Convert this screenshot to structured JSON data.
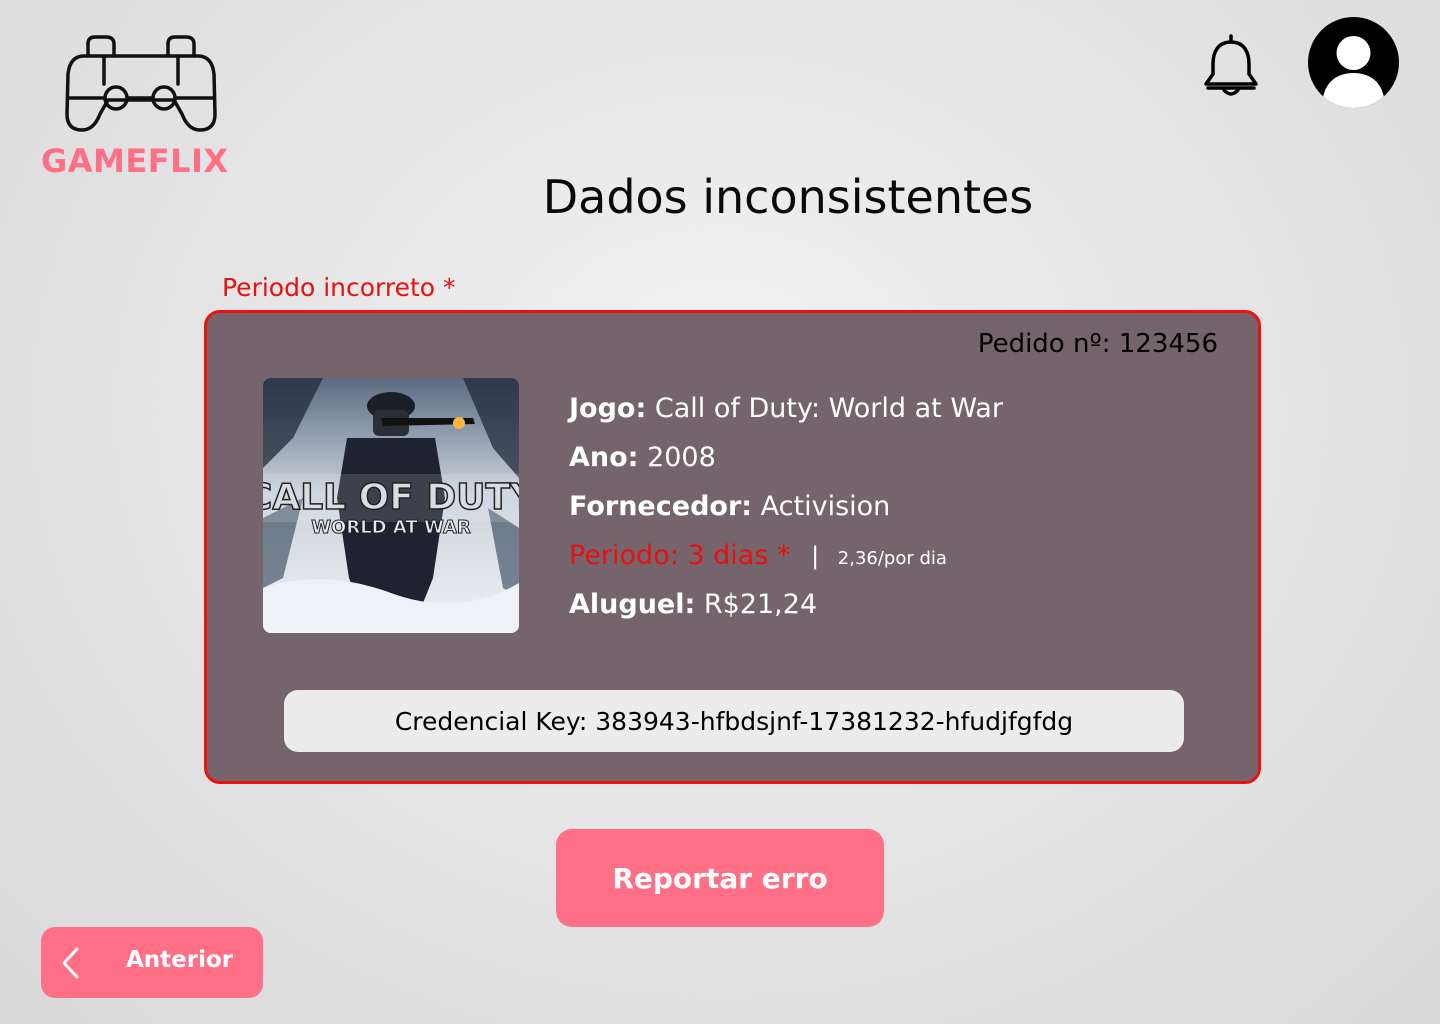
{
  "brand": {
    "name": "GAMEFLIX",
    "icon": "gamepad-icon"
  },
  "header": {
    "notifications_icon": "bell-icon",
    "profile_icon": "user-avatar-icon"
  },
  "page": {
    "title": "Dados inconsistentes",
    "error_label": "Periodo incorreto *"
  },
  "order": {
    "number_label": "Pedido nº: 123456",
    "cover_text": {
      "line1": "CALL OF DUTY",
      "line2": "WORLD AT WAR"
    },
    "game_key": "Jogo:",
    "game_value": "Call of Duty: World at War",
    "year_key": "Ano:",
    "year_value": "2008",
    "supplier_key": "Fornecedor:",
    "supplier_value": "Activision",
    "period_text": "Periodo: 3 dias *",
    "separator": "|",
    "daily_rate": "2,36/por dia",
    "rent_key": "Aluguel:",
    "rent_value": "R$21,24",
    "credential": "Credencial Key: 383943-hfbdsjnf-17381232-hfudjfgfdg"
  },
  "actions": {
    "report_label": "Reportar erro",
    "previous_label": "Anterior"
  },
  "colors": {
    "accent": "#ff6f86",
    "error": "#e81010",
    "card_bg": "#76646d"
  }
}
